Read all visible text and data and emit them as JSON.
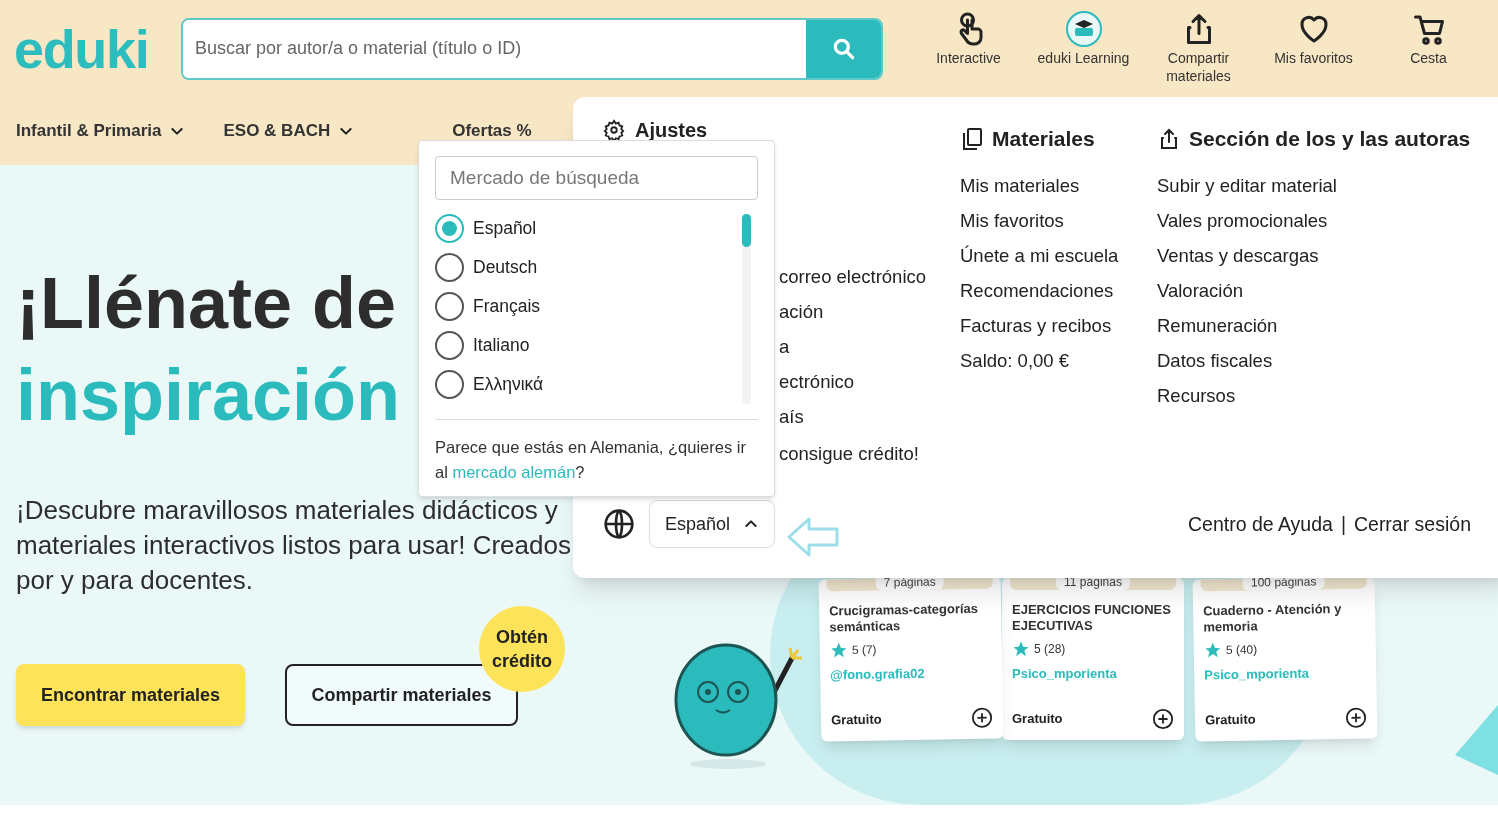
{
  "header": {
    "logo": "eduki",
    "search": {
      "placeholder": "Buscar por autor/a o material (título o ID)"
    },
    "nav_icons": [
      {
        "kind": "interactive",
        "label": "Interactive"
      },
      {
        "kind": "learning",
        "label": "eduki Learning"
      },
      {
        "kind": "share",
        "label": "Compartir materiales"
      },
      {
        "kind": "heart",
        "label": "Mis favoritos"
      },
      {
        "kind": "cart",
        "label": "Cesta"
      }
    ]
  },
  "category_nav": [
    {
      "label": "Infantil & Primaria",
      "dropdown": true
    },
    {
      "label": "ESO & BACH",
      "dropdown": true
    },
    {
      "label": "Ofertas %",
      "dropdown": false
    }
  ],
  "hero": {
    "title_line_1": "¡Llénate de",
    "title_line_2": "inspiración",
    "description": "¡Descubre maravillosos materiales didácticos y materiales interactivos listos para usar! Creados por y para docentes.",
    "buttons": [
      {
        "kind": "primary",
        "label": "Encontrar materiales"
      },
      {
        "kind": "outline",
        "label": "Compartir materiales"
      }
    ],
    "badge": "Obtén crédito",
    "cards": [
      {
        "pages": "7 páginas",
        "title": "Crucigramas-categorías semánticas",
        "rating": "5 (7)",
        "author": "@fono.grafia02",
        "price": "Gratuito"
      },
      {
        "pages": "11 páginas",
        "title": "EJERCICIOS FUNCIONES EJECUTIVAS",
        "rating": "5 (28)",
        "author": "Psico_mporienta",
        "price": "Gratuito"
      },
      {
        "pages": "100 páginas",
        "title": "Cuaderno - Atención y memoria",
        "rating": "5 (40)",
        "author": "Psico_mporienta",
        "price": "Gratuito"
      }
    ]
  },
  "account_menu": {
    "settings": {
      "title": "Ajustes",
      "items": [
        "correo electrónico",
        "ación",
        "a",
        "ectrónico",
        "aís",
        "consigue crédito!"
      ]
    },
    "materials": {
      "title": "Materiales",
      "items": [
        "Mis materiales",
        "Mis favoritos",
        "Únete a mi escuela",
        "Recomendaciones",
        "Facturas y recibos",
        "Saldo: 0,00 €"
      ]
    },
    "author_section": {
      "title": "Sección de los y las autoras",
      "items": [
        "Subir y editar material",
        "Vales promocionales",
        "Ventas y descargas",
        "Valoración",
        "Remuneración",
        "Datos fiscales",
        "Recursos"
      ]
    },
    "language_select": {
      "value": "Español",
      "expanded": true
    },
    "footer_links": [
      "Centro de Ayuda",
      "Cerrar sesión"
    ],
    "footer_separator": "|"
  },
  "market_popup": {
    "search": {
      "placeholder": "Mercado de búsqueda"
    },
    "options": [
      {
        "label": "Español",
        "selected": true
      },
      {
        "label": "Deutsch",
        "selected": false
      },
      {
        "label": "Français",
        "selected": false
      },
      {
        "label": "Italiano",
        "selected": false
      },
      {
        "label": "Ελληνικά",
        "selected": false
      }
    ],
    "notice": "Parece que estás en Alemania, ¿quieres ir al ",
    "notice_link": "mercado alemán",
    "notice_end": "?"
  }
}
